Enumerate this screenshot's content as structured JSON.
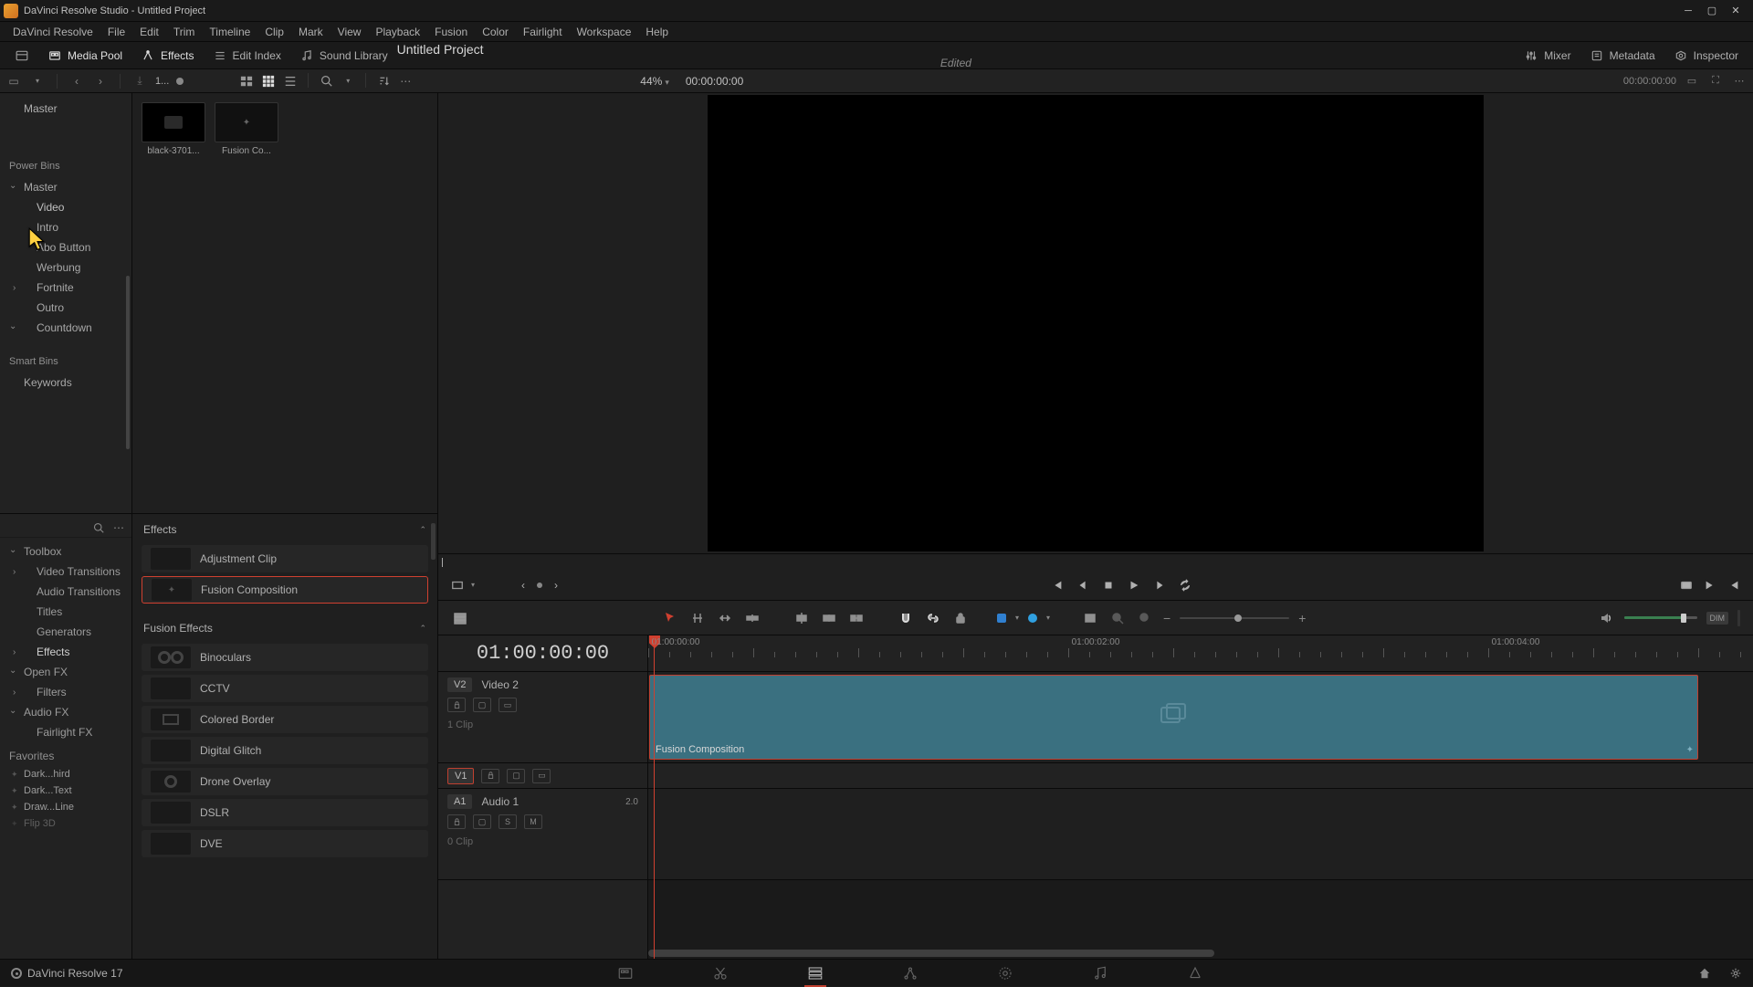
{
  "window": {
    "title": "DaVinci Resolve Studio - Untitled Project"
  },
  "menubar": [
    "DaVinci Resolve",
    "File",
    "Edit",
    "Trim",
    "Timeline",
    "Clip",
    "Mark",
    "View",
    "Playback",
    "Fusion",
    "Color",
    "Fairlight",
    "Workspace",
    "Help"
  ],
  "toolbar": {
    "left": [
      {
        "icon": "layout-icon",
        "label": ""
      },
      {
        "icon": "media-pool-icon",
        "label": "Media Pool",
        "active": true
      },
      {
        "icon": "effects-icon",
        "label": "Effects",
        "active": true
      },
      {
        "icon": "edit-index-icon",
        "label": "Edit Index"
      },
      {
        "icon": "sound-library-icon",
        "label": "Sound Library"
      }
    ],
    "project_title": "Untitled Project",
    "project_status": "Edited",
    "right": [
      {
        "icon": "mixer-icon",
        "label": "Mixer"
      },
      {
        "icon": "metadata-icon",
        "label": "Metadata"
      },
      {
        "icon": "inspector-icon",
        "label": "Inspector"
      }
    ]
  },
  "secondary": {
    "pool_dropdown": "1...",
    "zoom": "44%",
    "tc_left": "00:00:00:00",
    "tc_right": "00:00:00:00"
  },
  "bins": {
    "top": "Master",
    "power_bins_label": "Power Bins",
    "master": "Master",
    "items": [
      {
        "label": "Video",
        "child": true
      },
      {
        "label": "Intro",
        "child": true
      },
      {
        "label": "Abo Button",
        "child": true
      },
      {
        "label": "Werbung",
        "child": true
      },
      {
        "label": "Fortnite",
        "child": true,
        "expandable": true
      },
      {
        "label": "Outro",
        "child": true
      },
      {
        "label": "Countdown",
        "child": true,
        "expandable": true,
        "expanded": true
      }
    ],
    "smart_bins_label": "Smart Bins",
    "keywords": "Keywords"
  },
  "thumbs": [
    {
      "label": "black-3701...",
      "dark": true
    },
    {
      "label": "Fusion Co...",
      "fusion": true
    }
  ],
  "effects_tree": {
    "toolbox": "Toolbox",
    "items": [
      {
        "label": "Video Transitions",
        "expandable": true
      },
      {
        "label": "Audio Transitions"
      },
      {
        "label": "Titles"
      },
      {
        "label": "Generators"
      },
      {
        "label": "Effects",
        "bold": true,
        "expandable": true
      }
    ],
    "openfx": "Open FX",
    "filters": "Filters",
    "audiofx": "Audio FX",
    "fairlightfx": "Fairlight FX",
    "favorites_label": "Favorites",
    "favorites": [
      "Dark...hird",
      "Dark...Text",
      "Draw...Line",
      "Flip 3D"
    ]
  },
  "effects_list": {
    "section1": "Effects",
    "items1": [
      {
        "label": "Adjustment Clip"
      },
      {
        "label": "Fusion Composition",
        "selected": true
      }
    ],
    "section2": "Fusion Effects",
    "items2": [
      {
        "label": "Binoculars",
        "icon": "donut"
      },
      {
        "label": "CCTV"
      },
      {
        "label": "Colored Border",
        "icon": "rect"
      },
      {
        "label": "Digital Glitch"
      },
      {
        "label": "Drone Overlay",
        "icon": "donut-single"
      },
      {
        "label": "DSLR"
      },
      {
        "label": "DVE"
      }
    ]
  },
  "timeline": {
    "tc": "01:00:00:00",
    "ruler_labels": [
      "01:00:00:00",
      "01:00:02:00",
      "01:00:04:00"
    ],
    "tracks": {
      "v2": {
        "badge": "V2",
        "name": "Video 2",
        "clip_count": "1 Clip"
      },
      "v1": {
        "badge": "V1"
      },
      "a1": {
        "badge": "A1",
        "name": "Audio 1",
        "level": "2.0",
        "clip_count": "0 Clip",
        "s": "S",
        "m": "M"
      }
    },
    "clip": {
      "label": "Fusion Composition"
    }
  },
  "bottom": {
    "app": "DaVinci Resolve 17"
  }
}
